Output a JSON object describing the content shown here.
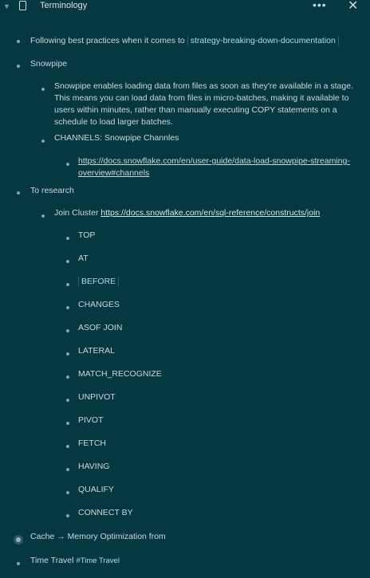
{
  "header": {
    "title": "Terminology",
    "more_glyph": "•••",
    "close_glyph": "✕"
  },
  "outline": {
    "item1": {
      "text": "Following best practices when it comes to",
      "tag": "strategy-breaking-down-documentation"
    },
    "snowpipe": {
      "label": "Snowpipe",
      "description": "Snowpipe enables loading data from files as soon as they're available in a stage. This means you can load data from files in micro-batches, making it available to users within minutes, rather than manually executing COPY statements on a schedule to load larger batches.",
      "channels_label": "CHANNELS: Snowpipe Channles",
      "channels_link": "https://docs.snowflake.com/en/user-guide/data-load-snowpipe-streaming-overview#channels"
    },
    "research": {
      "label": "To research",
      "join_prefix": "Join Cluster",
      "join_link": "https://docs.snowflake.com/en/sql-reference/constructs/join",
      "constructs": [
        "TOP",
        "AT",
        "BEFORE",
        "CHANGES",
        "ASOF JOIN",
        "LATERAL",
        "MATCH_RECOGNIZE",
        "UNPIVOT",
        "PIVOT",
        "FETCH",
        "HAVING",
        "QUALIFY",
        "CONNECT BY"
      ]
    },
    "cache": {
      "text": "Cache → Memory Optimization from"
    },
    "time_travel": {
      "text": "Time Travel",
      "hashtag": "#Time Travel"
    }
  }
}
